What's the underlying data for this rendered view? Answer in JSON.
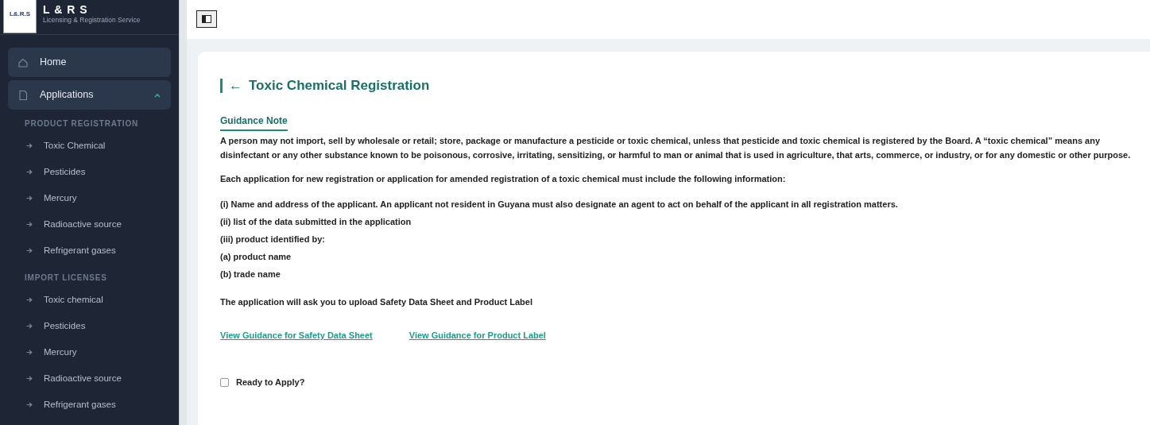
{
  "brand": {
    "title": "L & R S",
    "subtitle": "Licensing & Registration Service",
    "logo_text": "L&.R.S"
  },
  "sidebar": {
    "items": [
      {
        "label": "Home",
        "kind": "home"
      },
      {
        "label": "Applications",
        "kind": "document",
        "expanded": true
      }
    ],
    "sections": [
      {
        "heading": "PRODUCT REGISTRATION",
        "items": [
          "Toxic Chemical",
          "Pesticides",
          "Mercury",
          "Radioactive source",
          "Refrigerant gases"
        ]
      },
      {
        "heading": "IMPORT LICENSES",
        "items": [
          "Toxic chemical",
          "Pesticides",
          "Mercury",
          "Radioactive source",
          "Refrigerant gases"
        ]
      }
    ]
  },
  "page": {
    "title": "Toxic Chemical Registration",
    "back": "←",
    "guidance_heading": "Guidance Note",
    "paragraphs": [
      "A person may not import, sell by wholesale or retail; store, package or manufacture a pesticide or toxic chemical, unless that pesticide and toxic chemical is registered by the Board. A “toxic chemical” means any disinfectant or any other substance known to be poisonous, corrosive, irritating, sensitizing, or harmful to man or animal that is used in agriculture, that arts, commerce, or industry, or for any domestic or other purpose.",
      "Each application for new registration or application for amended registration of a toxic chemical must include the following information:"
    ],
    "requirements": [
      "(i) Name and address of the applicant. An applicant not resident in Guyana must also designate an agent to act on behalf of the applicant in all registration matters.",
      "(ii) list of the data submitted in the application",
      "(iii) product identified by:",
      "(a) product name",
      "(b) trade name"
    ],
    "upload_note": "The application will ask you to upload Safety Data Sheet and Product Label",
    "links": [
      "View Guidance for Safety Data Sheet",
      "View Guidance for Product Label"
    ],
    "ready": {
      "label": "Ready to Apply?",
      "checked": false
    }
  }
}
